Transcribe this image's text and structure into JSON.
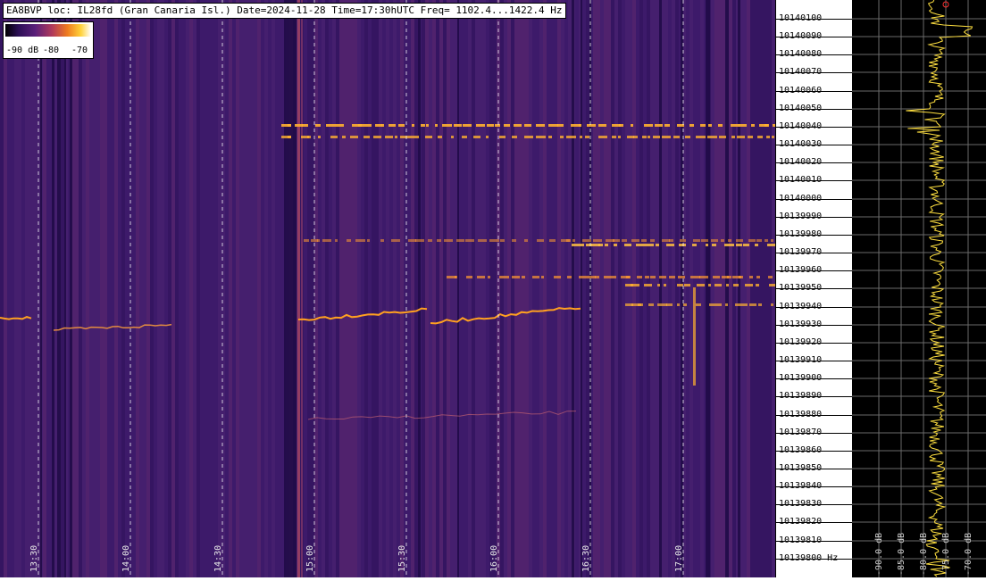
{
  "header": {
    "title": "EA8BVP loc: IL28fd (Gran Canaria Isl.) Date=2024-11-28 Time=17:30hUTC Freq= 1102.4...1422.4 Hz"
  },
  "legend": {
    "labels": [
      "-90 dB",
      "-80",
      "-70"
    ]
  },
  "time_axis": {
    "labels": [
      "13:30",
      "14:00",
      "14:30",
      "15:00",
      "15:30",
      "16:00",
      "16:30",
      "17:00"
    ]
  },
  "freq_axis": {
    "labels": [
      "10140100",
      "10140090",
      "10140080",
      "10140070",
      "10140060",
      "10140050",
      "10140040",
      "10140030",
      "10140020",
      "10140010",
      "10140000",
      "10139990",
      "10139980",
      "10139970",
      "10139960",
      "10139950",
      "10139940",
      "10139930",
      "10139920",
      "10139910",
      "10139900",
      "10139890",
      "10139880",
      "10139870",
      "10139860",
      "10139850",
      "10139840",
      "10139830",
      "10139820",
      "10139810",
      "10139800"
    ],
    "unit": "Hz"
  },
  "spectrum_axis": {
    "labels": [
      "-90.0 dB",
      "-85.0 dB",
      "-80.0 dB",
      "-75.0 dB",
      "-70.0 dB"
    ]
  },
  "colors": {
    "background": "#3c1a66",
    "trace": "#ffe040",
    "signal": "#ffb030"
  }
}
